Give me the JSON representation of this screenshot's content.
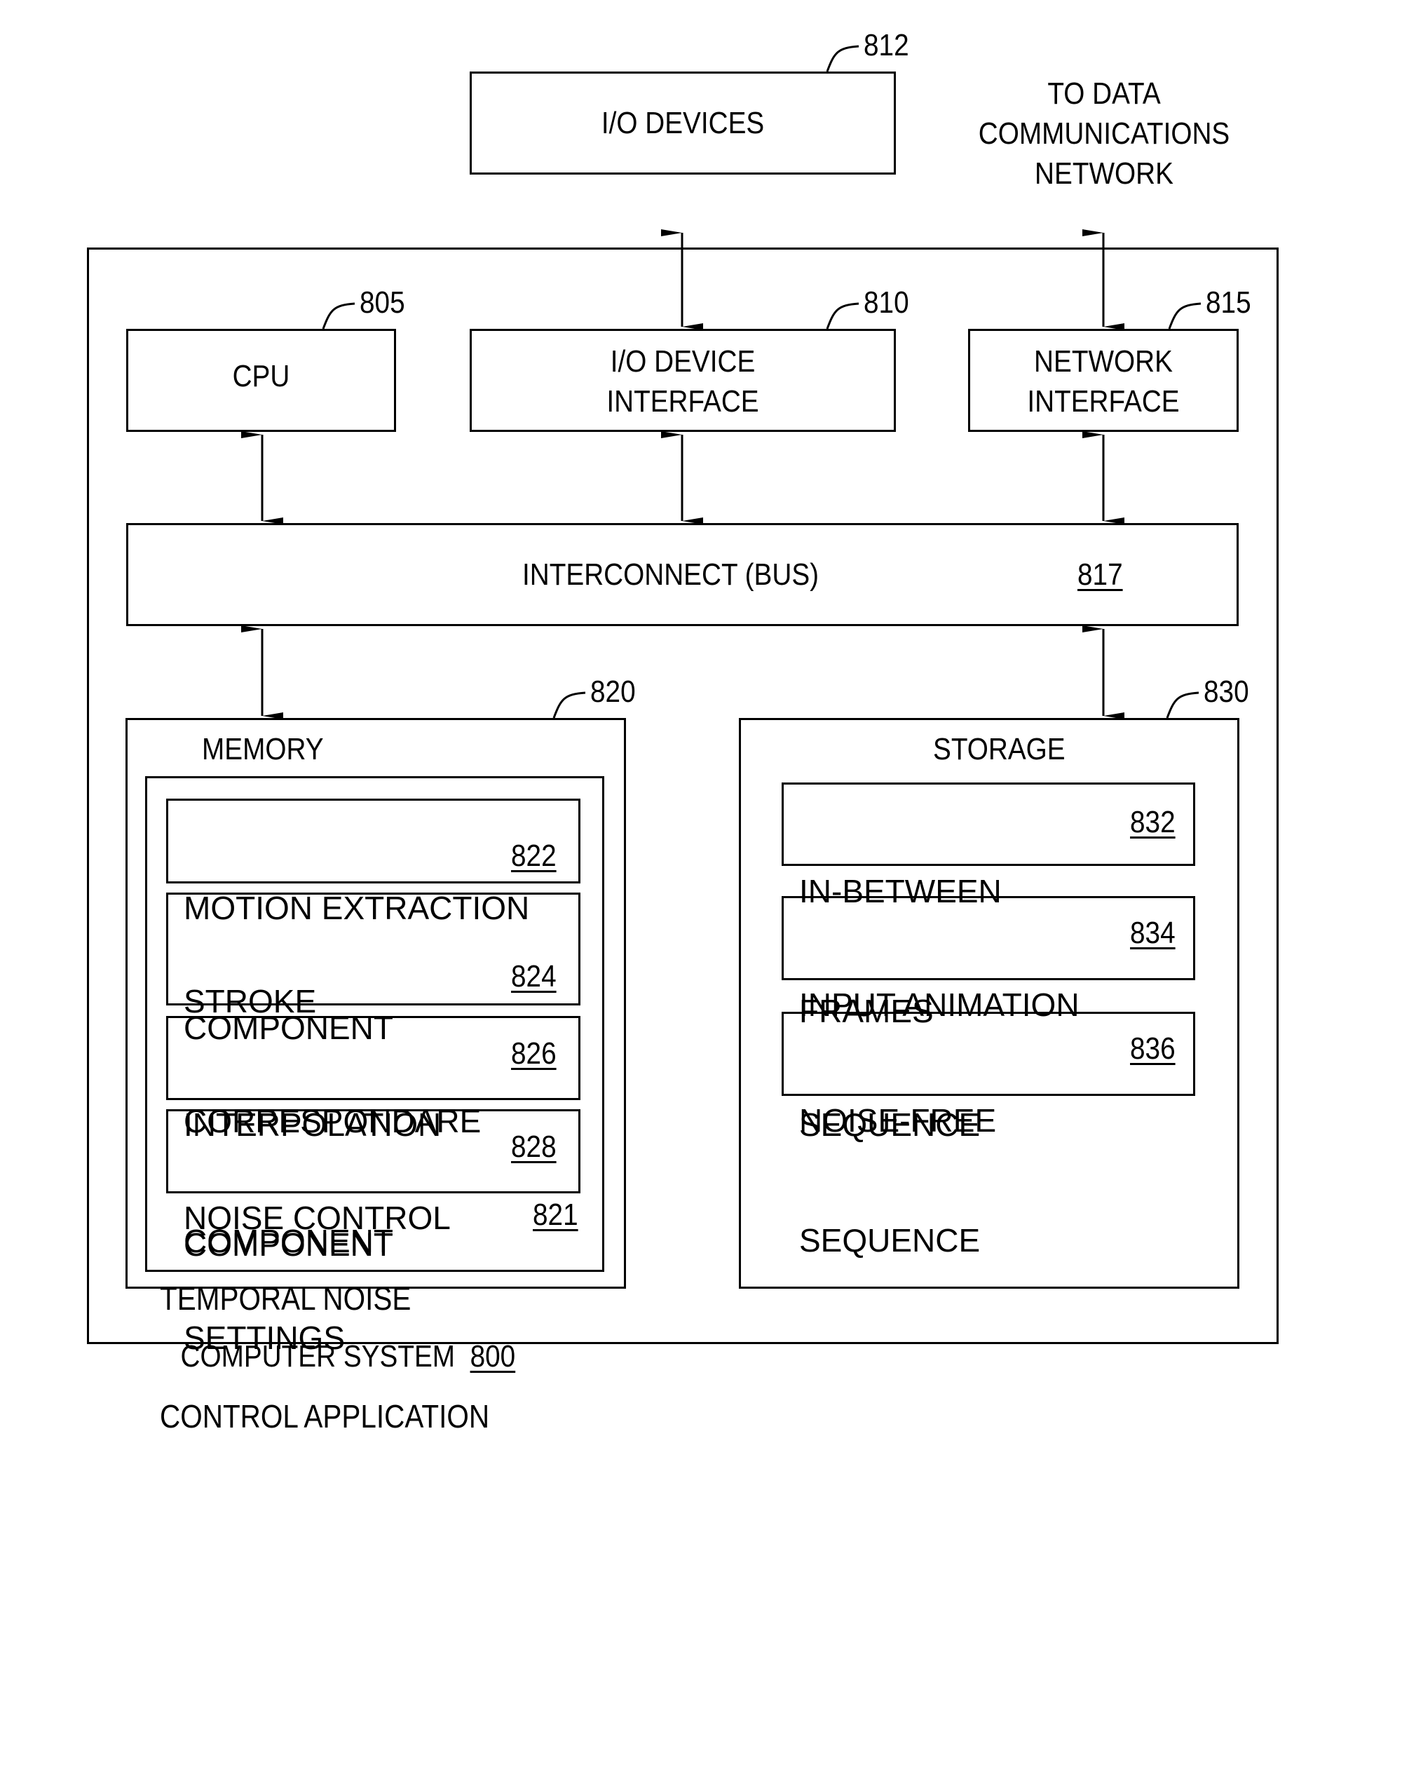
{
  "figure": {
    "io_devices": {
      "label": "I/O DEVICES",
      "ref": "812"
    },
    "network_destination": {
      "label_lines": [
        "TO DATA",
        "COMMUNICATIONS",
        "NETWORK"
      ]
    },
    "computer_system": {
      "label": "COMPUTER SYSTEM",
      "ref": "800"
    },
    "cpu": {
      "label": "CPU",
      "ref": "805"
    },
    "io_device_interface": {
      "label_lines": [
        "I/O DEVICE",
        "INTERFACE"
      ],
      "ref": "810"
    },
    "network_interface": {
      "label_lines": [
        "NETWORK",
        "INTERFACE"
      ],
      "ref": "815"
    },
    "bus": {
      "label": "INTERCONNECT (BUS)",
      "ref": "817"
    },
    "memory": {
      "label": "MEMORY",
      "ref": "820",
      "application": {
        "label_lines": [
          "TEMPORAL NOISE",
          "CONTROL APPLICATION"
        ],
        "ref": "821"
      },
      "components": [
        {
          "label_lines": [
            "MOTION EXTRACTION",
            "COMPONENT"
          ],
          "ref": "822"
        },
        {
          "label_lines": [
            "STROKE",
            "CORRESPONDARE",
            "COMPONENT"
          ],
          "ref": "824"
        },
        {
          "label_lines": [
            "INTERPOLATION",
            "COMPONENT"
          ],
          "ref": "826"
        },
        {
          "label_lines": [
            "NOISE CONTROL",
            "SETTINGS"
          ],
          "ref": "828"
        }
      ]
    },
    "storage": {
      "label": "STORAGE",
      "ref": "830",
      "items": [
        {
          "label_lines": [
            "IN-BETWEEN",
            "FRAMES"
          ],
          "ref": "832"
        },
        {
          "label_lines": [
            "INPUT ANIMATION",
            "SEQUENCE"
          ],
          "ref": "834"
        },
        {
          "label_lines": [
            "NOISE-FREE",
            "SEQUENCE"
          ],
          "ref": "836"
        }
      ]
    }
  }
}
